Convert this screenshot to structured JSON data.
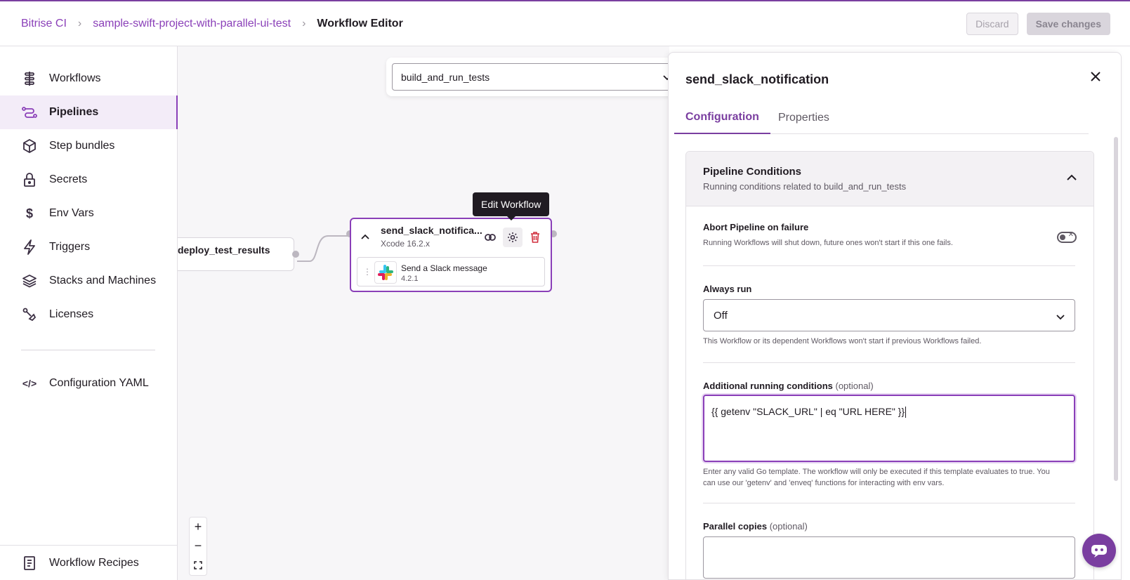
{
  "breadcrumb": {
    "org": "Bitrise CI",
    "project": "sample-swift-project-with-parallel-ui-test",
    "current": "Workflow Editor"
  },
  "toolbar": {
    "discard_label": "Discard",
    "save_label": "Save changes"
  },
  "sidebar": {
    "items": [
      {
        "label": "Workflows",
        "icon": "workflows-icon"
      },
      {
        "label": "Pipelines",
        "icon": "pipelines-icon",
        "active": true
      },
      {
        "label": "Step bundles",
        "icon": "cube-icon"
      },
      {
        "label": "Secrets",
        "icon": "lock-icon"
      },
      {
        "label": "Env Vars",
        "icon": "dollar-icon"
      },
      {
        "label": "Triggers",
        "icon": "lightning-icon"
      },
      {
        "label": "Stacks and Machines",
        "icon": "layers-icon"
      },
      {
        "label": "Licenses",
        "icon": "license-icon"
      }
    ],
    "yaml_label": "Configuration YAML",
    "recipes_label": "Workflow Recipes"
  },
  "canvas": {
    "workflow_select": "build_and_run_tests",
    "left_node_title": "deploy_test_results",
    "selected_node": {
      "title": "send_slack_notifica...",
      "subtitle": "Xcode 16.2.x",
      "step_name": "Send a Slack message",
      "step_version": "4.2.1"
    },
    "tooltip": "Edit Workflow",
    "zoom_in": "+",
    "zoom_out": "−"
  },
  "panel": {
    "title": "send_slack_notification",
    "tabs": [
      "Configuration",
      "Properties"
    ],
    "section_title": "Pipeline Conditions",
    "section_subtitle": "Running conditions related to build_and_run_tests",
    "abort_label": "Abort Pipeline on failure",
    "abort_help": "Running Workflows will shut down, future ones won't start if this one fails.",
    "abort_enabled": false,
    "always_run_label": "Always run",
    "always_run_value": "Off",
    "always_run_help": "This Workflow or its dependent Workflows won't start if previous Workflows failed.",
    "additional_label": "Additional running conditions",
    "optional": "(optional)",
    "additional_value": "{{ getenv \"SLACK_URL\" | eq \"URL HERE\" }}",
    "additional_help": "Enter any valid Go template. The workflow will only be executed if this template evaluates to true. You can use our 'getenv' and 'enveq' functions for interacting with env vars.",
    "parallel_label": "Parallel copies"
  },
  "colors": {
    "accent": "#8a3fb8",
    "danger": "#d12f3d"
  }
}
